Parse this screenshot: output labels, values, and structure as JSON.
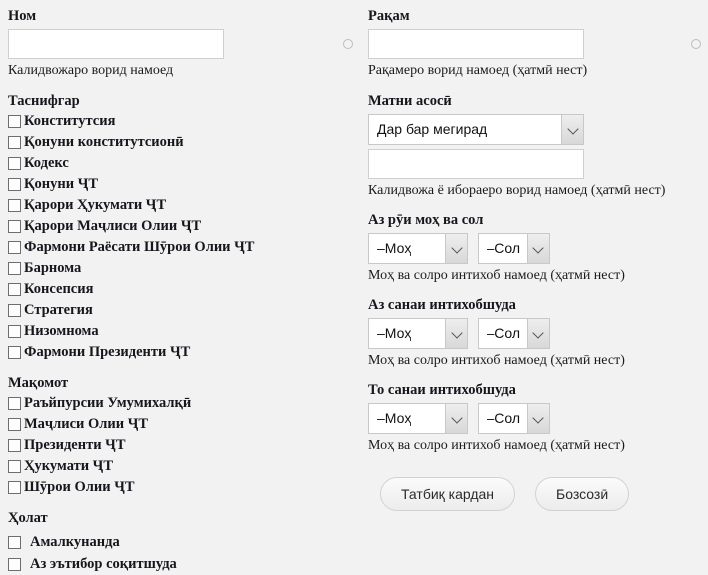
{
  "left": {
    "name_field": {
      "label": "Ном",
      "value": "",
      "placeholder": "",
      "help": "Калидвожаро ворид намоед",
      "spinner_icon": "circle-spinner-icon"
    },
    "classifier": {
      "heading": "Таснифгар",
      "options": [
        "Конститутсия",
        "Қонуни конститутсионӣ",
        "Кодекс",
        "Қонуни ҶТ",
        "Қарори Ҳукумати ҶТ",
        "Қарори Маҷлиси Олии ҶТ",
        "Фармони Раёсати Шӯрои Олии ҶТ",
        "Барнома",
        "Консепсия",
        "Стратегия",
        "Низомнома",
        "Фармони Президенти ҶТ"
      ]
    },
    "authority": {
      "heading": "Мақомот",
      "options": [
        "Раъйпурсии Умумихалқӣ",
        "Маҷлиси Олии ҶТ",
        "Президенти ҶТ",
        "Ҳукумати ҶТ",
        "Шӯрои Олии ҶТ"
      ]
    },
    "status": {
      "heading": "Ҳолат",
      "options": [
        "Амалкунанда",
        "Аз эътибор соқитшуда"
      ]
    }
  },
  "right": {
    "number_field": {
      "label": "Рақам",
      "value": "",
      "placeholder": "",
      "help": "Рақамеро ворид намоед (ҳатмӣ нест)",
      "spinner_icon": "circle-spinner-icon"
    },
    "maintext": {
      "label": "Матни асосӣ",
      "select_value": "Дар бар мегирад",
      "text_value": "",
      "text_placeholder": "",
      "help": "Калидвожа ё ибораеро ворид намоед (ҳатмӣ нест)"
    },
    "by_month_year": {
      "label": "Аз рӯи моҳ ва сол",
      "month_value": "–Моҳ",
      "year_value": "–Сол",
      "help": "Моҳ ва солро интихоб намоед (ҳатмӣ нест)"
    },
    "from_date": {
      "label": "Аз санаи интихобшуда",
      "month_value": "–Моҳ",
      "year_value": "–Сол",
      "help": "Моҳ ва солро интихоб намоед (ҳатмӣ нест)"
    },
    "to_date": {
      "label": "То санаи интихобшуда",
      "month_value": "–Моҳ",
      "year_value": "–Сол",
      "help": "Моҳ ва солро интихоб намоед (ҳатмӣ нест)"
    },
    "actions": {
      "apply_label": "Татбиқ кардан",
      "reset_label": "Бозсозӣ"
    }
  },
  "colors": {
    "page_bg": "#f2f2f2",
    "text": "#16161d",
    "input_border": "#cfcfcf",
    "checkbox_border": "#6e6e6e",
    "button_border": "#d2d2d2"
  }
}
